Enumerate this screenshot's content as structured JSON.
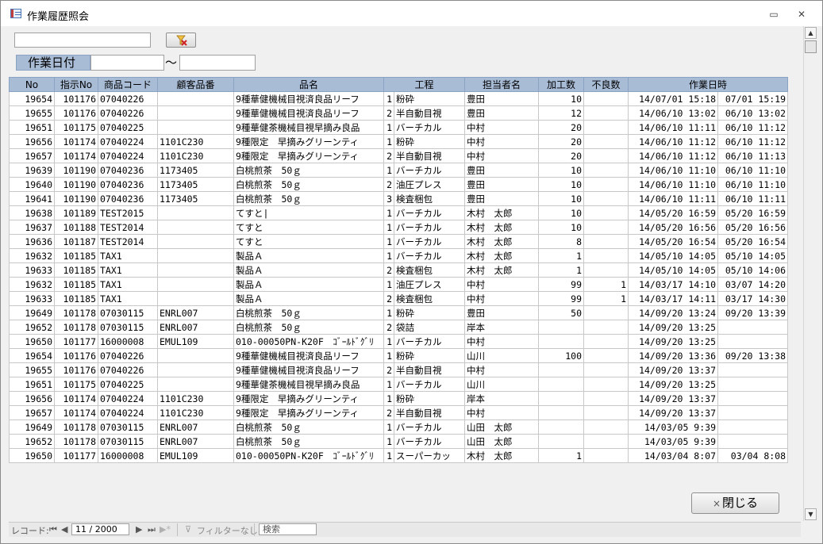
{
  "window": {
    "title": "作業履歴照会"
  },
  "titlebar": {
    "minimize": "▭",
    "maximize": "✕"
  },
  "filter": {
    "search_value": "",
    "date_label": "作業日付",
    "date_from": "",
    "date_to": "",
    "tilde": "〜"
  },
  "grid": {
    "headers": [
      "No",
      "指示No",
      "商品コード",
      "顧客品番",
      "品名",
      "工程",
      "担当者名",
      "加工数",
      "不良数",
      "作業日時"
    ],
    "rows": [
      [
        "19654",
        "101176",
        "07040226",
        "",
        "9種華健機械目視済良品リーフ",
        "1",
        "粉砕",
        "豊田",
        "10",
        "",
        "14/07/01 15:18",
        "07/01 15:19"
      ],
      [
        "19655",
        "101176",
        "07040226",
        "",
        "9種華健機械目視済良品リーフ",
        "2",
        "半自動目視",
        "豊田",
        "12",
        "",
        "14/06/10 13:02",
        "06/10 13:02"
      ],
      [
        "19651",
        "101175",
        "07040225",
        "",
        "9種華健茶機械目視早摘み良品",
        "1",
        "バーチカル",
        "中村",
        "20",
        "",
        "14/06/10 11:11",
        "06/10 11:12"
      ],
      [
        "19656",
        "101174",
        "07040224",
        "1101C230",
        "9種限定　早摘みグリーンティ",
        "1",
        "粉砕",
        "中村",
        "20",
        "",
        "14/06/10 11:12",
        "06/10 11:12"
      ],
      [
        "19657",
        "101174",
        "07040224",
        "1101C230",
        "9種限定　早摘みグリーンティ",
        "2",
        "半自動目視",
        "中村",
        "20",
        "",
        "14/06/10 11:12",
        "06/10 11:13"
      ],
      [
        "19639",
        "101190",
        "07040236",
        "1173405",
        "白桃煎茶　50ｇ",
        "1",
        "バーチカル",
        "豊田",
        "10",
        "",
        "14/06/10 11:10",
        "06/10 11:10"
      ],
      [
        "19640",
        "101190",
        "07040236",
        "1173405",
        "白桃煎茶　50ｇ",
        "2",
        "油圧プレス",
        "豊田",
        "10",
        "",
        "14/06/10 11:10",
        "06/10 11:10"
      ],
      [
        "19641",
        "101190",
        "07040236",
        "1173405",
        "白桃煎茶　50ｇ",
        "3",
        "検査梱包",
        "豊田",
        "10",
        "",
        "14/06/10 11:11",
        "06/10 11:11"
      ],
      [
        "19638",
        "101189",
        "TEST2015",
        "",
        "てすと|",
        "1",
        "バーチカル",
        "木村　太郎",
        "10",
        "",
        "14/05/20 16:59",
        "05/20 16:59"
      ],
      [
        "19637",
        "101188",
        "TEST2014",
        "",
        "てすと",
        "1",
        "バーチカル",
        "木村　太郎",
        "10",
        "",
        "14/05/20 16:56",
        "05/20 16:56"
      ],
      [
        "19636",
        "101187",
        "TEST2014",
        "",
        "てすと",
        "1",
        "バーチカル",
        "木村　太郎",
        "8",
        "",
        "14/05/20 16:54",
        "05/20 16:54"
      ],
      [
        "19632",
        "101185",
        "TAX1",
        "",
        "製品Ａ",
        "1",
        "バーチカル",
        "木村　太郎",
        "1",
        "",
        "14/05/10 14:05",
        "05/10 14:05"
      ],
      [
        "19633",
        "101185",
        "TAX1",
        "",
        "製品Ａ",
        "2",
        "検査梱包",
        "木村　太郎",
        "1",
        "",
        "14/05/10 14:05",
        "05/10 14:06"
      ],
      [
        "19632",
        "101185",
        "TAX1",
        "",
        "製品Ａ",
        "1",
        "油圧プレス",
        "中村",
        "99",
        "1",
        "14/03/17 14:10",
        "03/07 14:20"
      ],
      [
        "19633",
        "101185",
        "TAX1",
        "",
        "製品Ａ",
        "2",
        "検査梱包",
        "中村",
        "99",
        "1",
        "14/03/17 14:11",
        "03/17 14:30"
      ],
      [
        "19649",
        "101178",
        "07030115",
        "ENRL007",
        "白桃煎茶　50ｇ",
        "1",
        "粉砕",
        "豊田",
        "50",
        "",
        "14/09/20 13:24",
        "09/20 13:39"
      ],
      [
        "19652",
        "101178",
        "07030115",
        "ENRL007",
        "白桃煎茶　50ｇ",
        "2",
        "袋詰",
        "岸本",
        "",
        "",
        "14/09/20 13:25",
        ""
      ],
      [
        "19650",
        "101177",
        "16000008",
        "EMUL109",
        "010-00050PN-K20F　ｺﾞｰﾙﾄﾞｸﾞﾘ",
        "1",
        "バーチカル",
        "中村",
        "",
        "",
        "14/09/20 13:25",
        ""
      ],
      [
        "19654",
        "101176",
        "07040226",
        "",
        "9種華健機械目視済良品リーフ",
        "1",
        "粉砕",
        "山川",
        "100",
        "",
        "14/09/20 13:36",
        "09/20 13:38"
      ],
      [
        "19655",
        "101176",
        "07040226",
        "",
        "9種華健機械目視済良品リーフ",
        "2",
        "半自動目視",
        "中村",
        "",
        "",
        "14/09/20 13:37",
        ""
      ],
      [
        "19651",
        "101175",
        "07040225",
        "",
        "9種華健茶機械目視早摘み良品",
        "1",
        "バーチカル",
        "山川",
        "",
        "",
        "14/09/20 13:25",
        ""
      ],
      [
        "19656",
        "101174",
        "07040224",
        "1101C230",
        "9種限定　早摘みグリーンティ",
        "1",
        "粉砕",
        "岸本",
        "",
        "",
        "14/09/20 13:37",
        ""
      ],
      [
        "19657",
        "101174",
        "07040224",
        "1101C230",
        "9種限定　早摘みグリーンティ",
        "2",
        "半自動目視",
        "中村",
        "",
        "",
        "14/09/20 13:37",
        ""
      ],
      [
        "19649",
        "101178",
        "07030115",
        "ENRL007",
        "白桃煎茶　50ｇ",
        "1",
        "バーチカル",
        "山田　太郎",
        "",
        "",
        "14/03/05 9:39",
        ""
      ],
      [
        "19652",
        "101178",
        "07030115",
        "ENRL007",
        "白桃煎茶　50ｇ",
        "1",
        "バーチカル",
        "山田　太郎",
        "",
        "",
        "14/03/05 9:39",
        ""
      ],
      [
        "19650",
        "101177",
        "16000008",
        "EMUL109",
        "010-00050PN-K20F　ｺﾞｰﾙﾄﾞｸﾞﾘ",
        "1",
        "スーパーカッ",
        "木村　太郎",
        "1",
        "",
        "14/03/04 8:07",
        "03/04 8:08"
      ]
    ]
  },
  "close_button": {
    "icon": "×",
    "label": "閉じる"
  },
  "navbar": {
    "record_label": "レコード:",
    "first": "⏮",
    "prev": "◀",
    "next": "▶",
    "last": "⏭",
    "new": "▶*",
    "current": "11 / 2000",
    "filter_label": "フィルターなし",
    "search_placeholder": "検索"
  }
}
